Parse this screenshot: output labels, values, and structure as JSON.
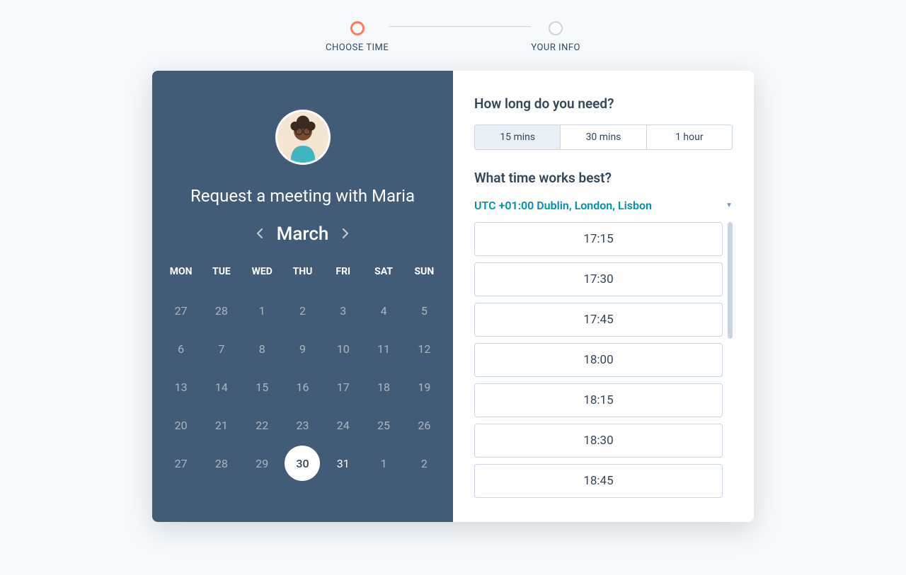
{
  "stepper": {
    "steps": [
      {
        "label": "CHOOSE TIME",
        "active": true
      },
      {
        "label": "YOUR INFO",
        "active": false
      }
    ]
  },
  "left": {
    "title": "Request a meeting with Maria",
    "month": "March",
    "weekdays": [
      "MON",
      "TUE",
      "WED",
      "THU",
      "FRI",
      "SAT",
      "SUN"
    ],
    "days": [
      [
        {
          "d": "27"
        },
        {
          "d": "28"
        },
        {
          "d": "1"
        },
        {
          "d": "2"
        },
        {
          "d": "3"
        },
        {
          "d": "4"
        },
        {
          "d": "5"
        }
      ],
      [
        {
          "d": "6"
        },
        {
          "d": "7"
        },
        {
          "d": "8"
        },
        {
          "d": "9"
        },
        {
          "d": "10"
        },
        {
          "d": "11"
        },
        {
          "d": "12"
        }
      ],
      [
        {
          "d": "13"
        },
        {
          "d": "14"
        },
        {
          "d": "15"
        },
        {
          "d": "16"
        },
        {
          "d": "17"
        },
        {
          "d": "18"
        },
        {
          "d": "19"
        }
      ],
      [
        {
          "d": "20"
        },
        {
          "d": "21"
        },
        {
          "d": "22"
        },
        {
          "d": "23"
        },
        {
          "d": "24"
        },
        {
          "d": "25"
        },
        {
          "d": "26"
        }
      ],
      [
        {
          "d": "27"
        },
        {
          "d": "28"
        },
        {
          "d": "29"
        },
        {
          "d": "30",
          "selected": true
        },
        {
          "d": "31",
          "available": true
        },
        {
          "d": "1"
        },
        {
          "d": "2"
        }
      ]
    ]
  },
  "right": {
    "duration_title": "How long do you need?",
    "durations": [
      {
        "label": "15 mins",
        "active": true
      },
      {
        "label": "30 mins",
        "active": false
      },
      {
        "label": "1 hour",
        "active": false
      }
    ],
    "time_title": "What time works best?",
    "timezone": "UTC +01:00 Dublin, London, Lisbon",
    "slots": [
      "17:15",
      "17:30",
      "17:45",
      "18:00",
      "18:15",
      "18:30",
      "18:45"
    ]
  }
}
